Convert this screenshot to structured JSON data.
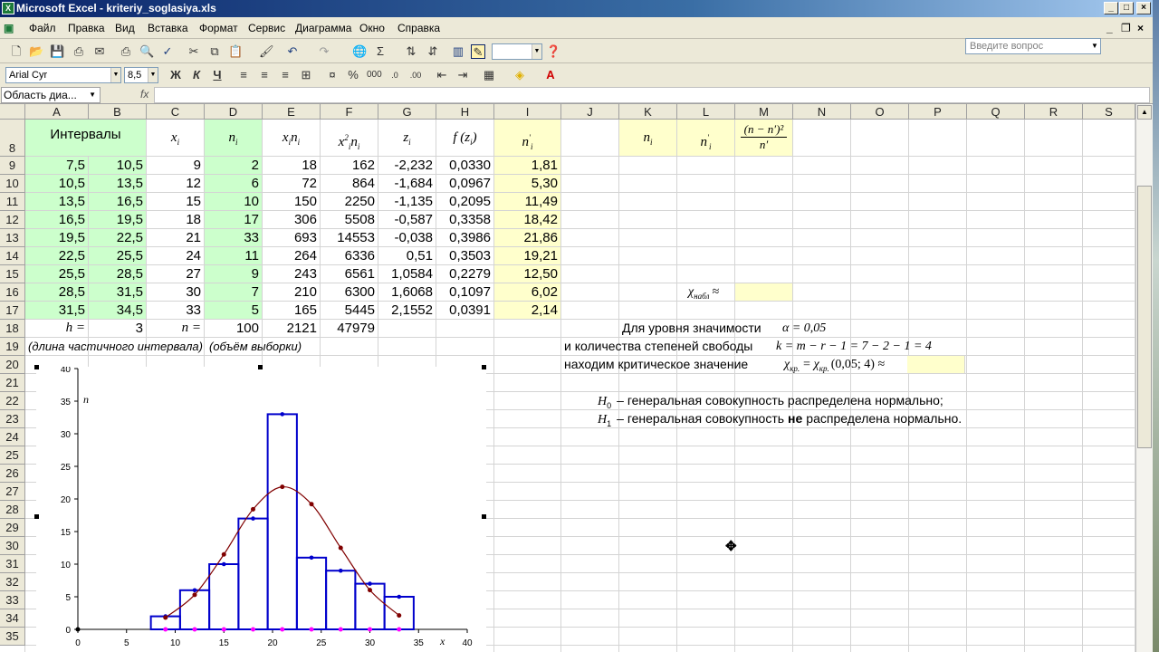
{
  "title": "Microsoft Excel - kriteriy_soglasiya.xls",
  "menu": [
    "Файл",
    "Правка",
    "Вид",
    "Вставка",
    "Формат",
    "Сервис",
    "Диаграмма",
    "Окно",
    "Справка"
  ],
  "question_placeholder": "Введите вопрос",
  "font_name": "Arial Cyr",
  "font_size": "8,5",
  "format_buttons": {
    "bold": "Ж",
    "italic": "К",
    "underline": "Ч"
  },
  "name_box": "Область диа...",
  "fx_label": "fx",
  "columns": [
    "A",
    "B",
    "C",
    "D",
    "E",
    "F",
    "G",
    "H",
    "I",
    "J",
    "K",
    "L",
    "M",
    "N",
    "O",
    "P",
    "Q",
    "R",
    "S"
  ],
  "rows": [
    "8",
    "9",
    "10",
    "11",
    "12",
    "13",
    "14",
    "15",
    "16",
    "17",
    "18",
    "19",
    "20",
    "21",
    "22",
    "23",
    "24",
    "25",
    "26",
    "27",
    "28",
    "29",
    "30",
    "31",
    "32",
    "33",
    "34",
    "35"
  ],
  "table": {
    "h_intervals": "Интервалы",
    "h_x": "x",
    "h_n": "n",
    "h_xn": "x",
    "h_x2n": "x",
    "h_z": "z",
    "h_f": "f (z",
    "h_nprime": "n",
    "data": [
      [
        "7,5",
        "10,5",
        "9",
        "2",
        "18",
        "162",
        "-2,232",
        "0,0330",
        "1,81"
      ],
      [
        "10,5",
        "13,5",
        "12",
        "6",
        "72",
        "864",
        "-1,684",
        "0,0967",
        "5,30"
      ],
      [
        "13,5",
        "16,5",
        "15",
        "10",
        "150",
        "2250",
        "-1,135",
        "0,2095",
        "11,49"
      ],
      [
        "16,5",
        "19,5",
        "18",
        "17",
        "306",
        "5508",
        "-0,587",
        "0,3358",
        "18,42"
      ],
      [
        "19,5",
        "22,5",
        "21",
        "33",
        "693",
        "14553",
        "-0,038",
        "0,3986",
        "21,86"
      ],
      [
        "22,5",
        "25,5",
        "24",
        "11",
        "264",
        "6336",
        "0,51",
        "0,3503",
        "19,21"
      ],
      [
        "25,5",
        "28,5",
        "27",
        "9",
        "243",
        "6561",
        "1,0584",
        "0,2279",
        "12,50"
      ],
      [
        "28,5",
        "31,5",
        "30",
        "7",
        "210",
        "6300",
        "1,6068",
        "0,1097",
        "6,02"
      ],
      [
        "31,5",
        "34,5",
        "33",
        "5",
        "165",
        "5445",
        "2,1552",
        "0,0391",
        "2,14"
      ]
    ],
    "h_label": "h =",
    "h_value": "3",
    "n_label": "n =",
    "n_value": "100",
    "sum_xn": "2121",
    "sum_x2n": "47979",
    "note_h": "(длина частичного интервала)",
    "note_n": "(объём выборки)"
  },
  "right": {
    "k_header": "n",
    "l_header": "n",
    "m_num": "(n",
    "m_den": "n",
    "chi_obs_label": "χ",
    "chi_obs_sub": "набл",
    "approx": "≈",
    "line1": "Для уровня значимости",
    "alpha": "α = 0,05",
    "line2": "и количества степеней свободы",
    "df": "k = m − r − 1 = 7 − 2 − 1 = 4",
    "line3": "находим критическое значение",
    "chi_cr": "χ",
    "chi_cr_sub": "кр.",
    "chi_cr_expr": "(0,05; 4) ≈",
    "h0": "H",
    "h0_text": "– генеральная совокупность распределена нормально;",
    "h1": "H",
    "h1_text_a": "– генеральная совокупность",
    "h1_not": "не",
    "h1_text_b": "распределена нормально."
  },
  "chart_data": {
    "type": "bar",
    "x": [
      9,
      12,
      15,
      18,
      21,
      24,
      27,
      30,
      33
    ],
    "series": [
      {
        "values": [
          2,
          6,
          10,
          17,
          33,
          11,
          9,
          7,
          5
        ],
        "color": "#0000cc"
      },
      {
        "values": [
          1.81,
          5.3,
          11.49,
          18.42,
          21.86,
          19.21,
          12.5,
          6.02,
          2.14
        ],
        "color": "#800000"
      },
      {
        "values": [
          0,
          0,
          0,
          0,
          0,
          0,
          0,
          0,
          0
        ],
        "color": "#ff00ff"
      }
    ],
    "ylabel": "n",
    "xlabel": "x",
    "xlim": [
      0,
      40
    ],
    "ylim": [
      0,
      40
    ],
    "xticks": [
      "0",
      "5",
      "10",
      "15",
      "20",
      "25",
      "30",
      "35",
      "40"
    ],
    "yticks": [
      "0",
      "5",
      "10",
      "15",
      "20",
      "25",
      "30",
      "35",
      "40"
    ],
    "bar_width": 3
  },
  "colors": {
    "green_fill": "#ccffcc",
    "yellow_fill": "#ffffcc",
    "title_bar": "#0a246a"
  }
}
